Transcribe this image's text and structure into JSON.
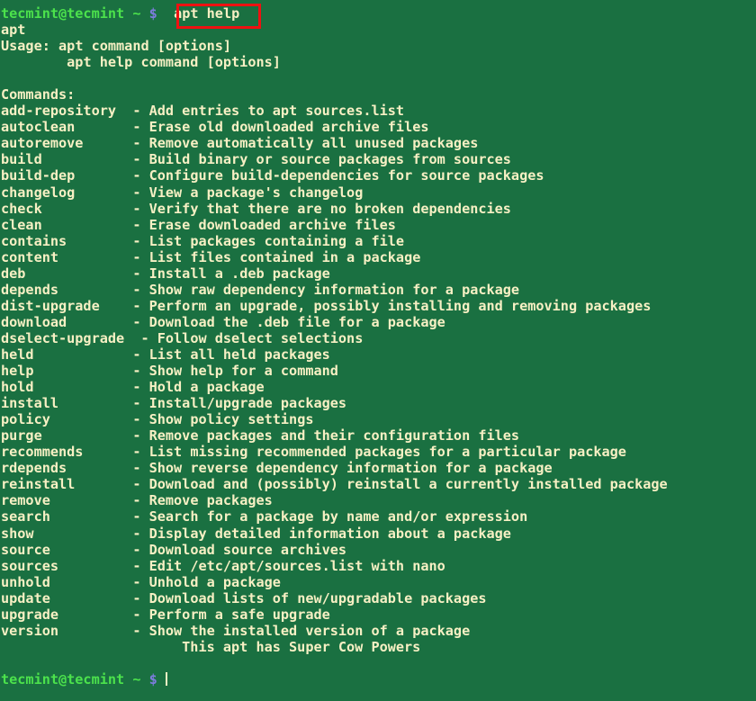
{
  "terminal": {
    "background_color": "#1a7041",
    "text_color": "#f7f0c4",
    "user_color": "#4ce24c",
    "prompt_symbol_color": "#7d7ddd",
    "highlight_border_color": "#ee1111"
  },
  "prompt": {
    "user_host": "tecmint@tecmint",
    "path": "~",
    "symbol": "$"
  },
  "command": {
    "typed": "apt help"
  },
  "output": {
    "program_name": "apt",
    "usage_label": "Usage:",
    "usage_lines": [
      "apt command [options]",
      "apt help command [options]"
    ],
    "commands_label": "Commands:",
    "command_column_width": 15,
    "separator": "-",
    "commands": [
      {
        "name": "add-repository",
        "description": "Add entries to apt sources.list"
      },
      {
        "name": "autoclean",
        "description": "Erase old downloaded archive files"
      },
      {
        "name": "autoremove",
        "description": "Remove automatically all unused packages"
      },
      {
        "name": "build",
        "description": "Build binary or source packages from sources"
      },
      {
        "name": "build-dep",
        "description": "Configure build-dependencies for source packages"
      },
      {
        "name": "changelog",
        "description": "View a package's changelog"
      },
      {
        "name": "check",
        "description": "Verify that there are no broken dependencies"
      },
      {
        "name": "clean",
        "description": "Erase downloaded archive files"
      },
      {
        "name": "contains",
        "description": "List packages containing a file"
      },
      {
        "name": "content",
        "description": "List files contained in a package"
      },
      {
        "name": "deb",
        "description": "Install a .deb package"
      },
      {
        "name": "depends",
        "description": "Show raw dependency information for a package"
      },
      {
        "name": "dist-upgrade",
        "description": "Perform an upgrade, possibly installing and removing packages"
      },
      {
        "name": "download",
        "description": "Download the .deb file for a package"
      },
      {
        "name": "dselect-upgrade",
        "description": "Follow dselect selections"
      },
      {
        "name": "held",
        "description": "List all held packages"
      },
      {
        "name": "help",
        "description": "Show help for a command"
      },
      {
        "name": "hold",
        "description": "Hold a package"
      },
      {
        "name": "install",
        "description": "Install/upgrade packages"
      },
      {
        "name": "policy",
        "description": "Show policy settings"
      },
      {
        "name": "purge",
        "description": "Remove packages and their configuration files"
      },
      {
        "name": "recommends",
        "description": "List missing recommended packages for a particular package"
      },
      {
        "name": "rdepends",
        "description": "Show reverse dependency information for a package"
      },
      {
        "name": "reinstall",
        "description": "Download and (possibly) reinstall a currently installed package"
      },
      {
        "name": "remove",
        "description": "Remove packages"
      },
      {
        "name": "search",
        "description": "Search for a package by name and/or expression"
      },
      {
        "name": "show",
        "description": "Display detailed information about a package"
      },
      {
        "name": "source",
        "description": "Download source archives"
      },
      {
        "name": "sources",
        "description": "Edit /etc/apt/sources.list with nano"
      },
      {
        "name": "unhold",
        "description": "Unhold a package"
      },
      {
        "name": "update",
        "description": "Download lists of new/upgradable packages"
      },
      {
        "name": "upgrade",
        "description": "Perform a safe upgrade"
      },
      {
        "name": "version",
        "description": "Show the installed version of a package"
      }
    ],
    "footer": "This apt has Super Cow Powers",
    "footer_indent": 22
  }
}
